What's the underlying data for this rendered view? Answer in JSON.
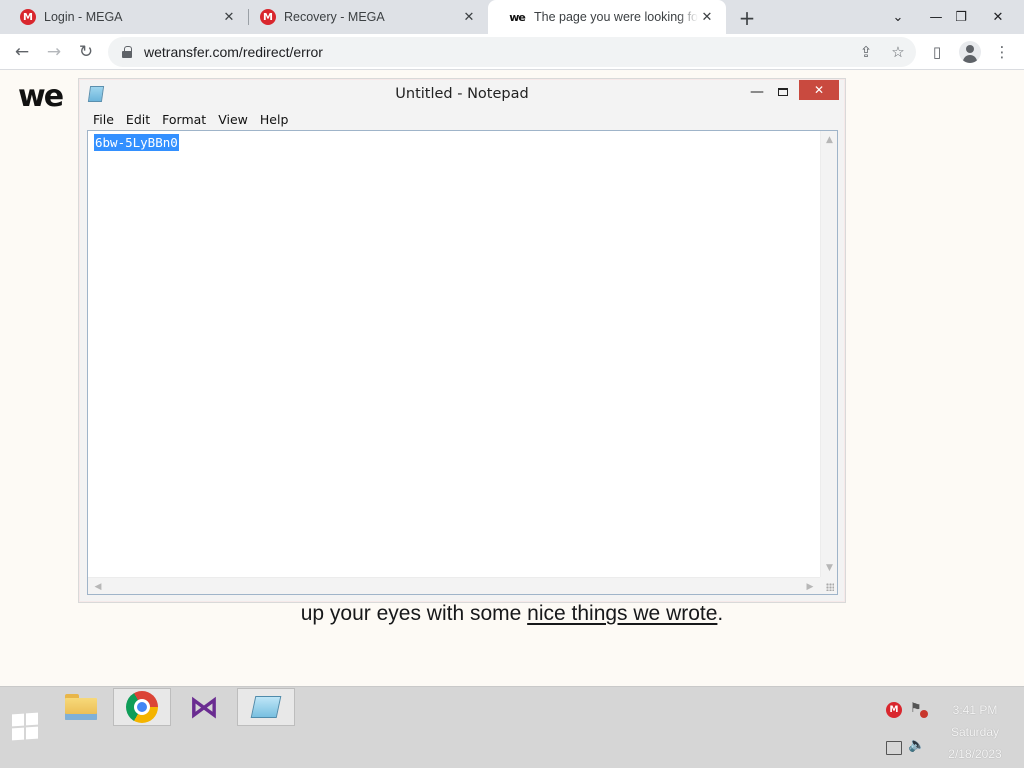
{
  "browser": {
    "tabs": [
      {
        "title": "Login - MEGA",
        "favicon": "mega-icon"
      },
      {
        "title": "Recovery - MEGA",
        "favicon": "mega-icon"
      },
      {
        "title": "The page you were looking for does not exist",
        "favicon": "wetransfer-icon"
      }
    ],
    "url": "wetransfer.com/redirect/error",
    "mega_badge": "M",
    "we_badge": "we"
  },
  "page": {
    "logo": "we",
    "text_before": "up your eyes with some ",
    "link_text": "nice things we wrote",
    "text_after": "."
  },
  "notepad": {
    "title": "Untitled - Notepad",
    "menu": [
      "File",
      "Edit",
      "Format",
      "View",
      "Help"
    ],
    "content": "6bw-5LyBBn0",
    "selection_color": "#3390ff"
  },
  "taskbar": {
    "apps": [
      "file-explorer-icon",
      "chrome-icon",
      "visual-studio-icon",
      "notepad-icon"
    ],
    "clock": {
      "time": "3:41 PM",
      "day": "Saturday",
      "date": "2/18/2023"
    }
  },
  "colors": {
    "mega_red": "#d9272e",
    "close_red": "#c94a3f",
    "page_bg": "#fdfaf5"
  }
}
